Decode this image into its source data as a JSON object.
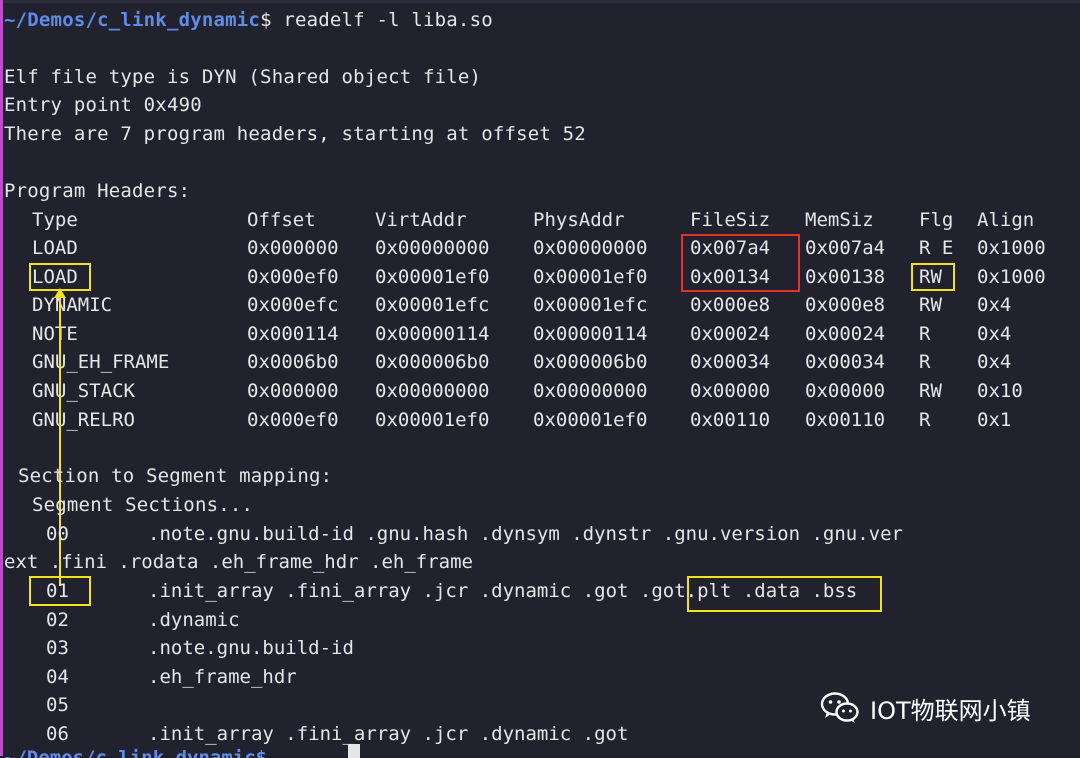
{
  "prompt": {
    "path": "~/Demos/c_link_dynamic",
    "dollar": "$ ",
    "command": "readelf -l liba.so"
  },
  "header_lines": [
    "Elf file type is DYN (Shared object file)",
    "Entry point 0x490",
    "There are 7 program headers, starting at offset 52"
  ],
  "program_headers": {
    "title": "Program Headers:",
    "columns": [
      "Type",
      "Offset",
      "VirtAddr",
      "PhysAddr",
      "FileSiz",
      "MemSiz",
      "Flg",
      "Align"
    ],
    "rows": [
      [
        "LOAD",
        "0x000000",
        "0x00000000",
        "0x00000000",
        "0x007a4",
        "0x007a4",
        "R E",
        "0x1000"
      ],
      [
        "LOAD",
        "0x000ef0",
        "0x00001ef0",
        "0x00001ef0",
        "0x00134",
        "0x00138",
        "RW",
        "0x1000"
      ],
      [
        "DYNAMIC",
        "0x000efc",
        "0x00001efc",
        "0x00001efc",
        "0x000e8",
        "0x000e8",
        "RW",
        "0x4"
      ],
      [
        "NOTE",
        "0x000114",
        "0x00000114",
        "0x00000114",
        "0x00024",
        "0x00024",
        "R",
        "0x4"
      ],
      [
        "GNU_EH_FRAME",
        "0x0006b0",
        "0x000006b0",
        "0x000006b0",
        "0x00034",
        "0x00034",
        "R",
        "0x4"
      ],
      [
        "GNU_STACK",
        "0x000000",
        "0x00000000",
        "0x00000000",
        "0x00000",
        "0x00000",
        "RW",
        "0x10"
      ],
      [
        "GNU_RELRO",
        "0x000ef0",
        "0x00001ef0",
        "0x00001ef0",
        "0x00110",
        "0x00110",
        "R",
        "0x1"
      ]
    ]
  },
  "mapping": {
    "title": "Section to Segment mapping:",
    "header": "Segment Sections...",
    "rows": [
      {
        "seg": "00",
        "sections": ".note.gnu.build-id .gnu.hash .dynsym .dynstr .gnu.version .gnu.ver"
      },
      {
        "seg": "",
        "sections": "ext .fini .rodata .eh_frame_hdr .eh_frame",
        "wrap": true
      },
      {
        "seg": "01",
        "sections_a": ".init_array .fini_array .jcr .dynamic ",
        "sections_b": ".got .got.plt",
        "sections_c": " .data .bss"
      },
      {
        "seg": "02",
        "sections": ".dynamic"
      },
      {
        "seg": "03",
        "sections": ".note.gnu.build-id"
      },
      {
        "seg": "04",
        "sections": ".eh_frame_hdr"
      },
      {
        "seg": "05",
        "sections": ""
      },
      {
        "seg": "06",
        "sections": ".init_array .fini_array .jcr .dynamic .got"
      }
    ]
  },
  "bottom_prompt": "~/Demos/c_link_dynamic$ ",
  "watermark": {
    "text": "IOT物联网小镇",
    "icon": "wechat-icon"
  },
  "colors": {
    "background": "#22222f",
    "prompt": "#5f8ce9",
    "highlight_yellow": "#f2e21a",
    "highlight_red": "#e0362a"
  }
}
